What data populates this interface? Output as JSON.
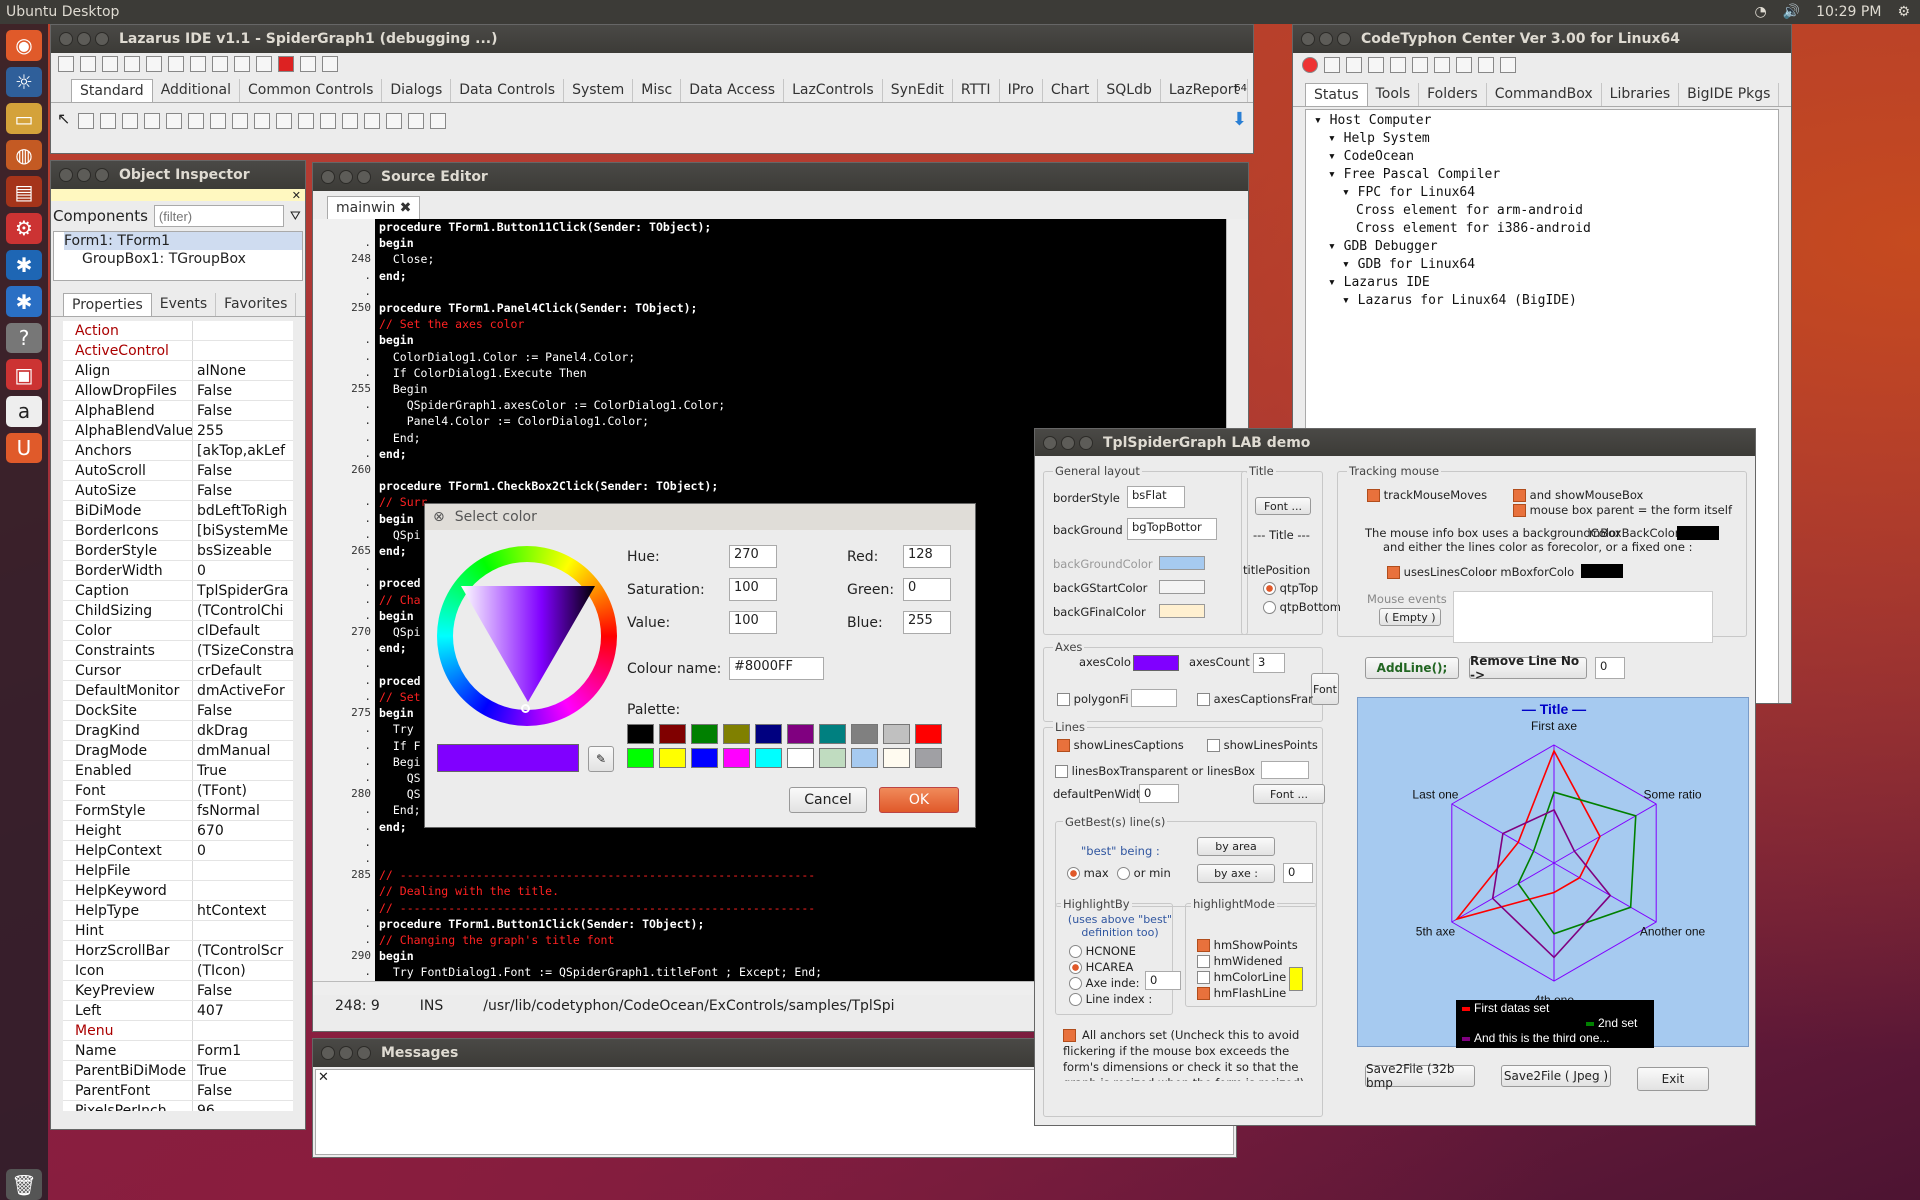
{
  "desktop": {
    "title": "Ubuntu Desktop",
    "time": "10:29 PM"
  },
  "lazarus": {
    "title": "Lazarus IDE v1.1 - SpiderGraph1 (debugging ...)",
    "tabs": [
      "Standard",
      "Additional",
      "Common Controls",
      "Dialogs",
      "Data Controls",
      "System",
      "Misc",
      "Data Access",
      "LazControls",
      "SynEdit",
      "RTTI",
      "IPro",
      "Chart",
      "SQLdb",
      "LazReport"
    ],
    "bits": "64"
  },
  "oi": {
    "title": "Object Inspector",
    "components_label": "Components",
    "filter_placeholder": "(filter)",
    "tree": [
      "Form1: TForm1",
      "GroupBox1: TGroupBox"
    ],
    "tabs": [
      "Properties",
      "Events",
      "Favorites"
    ],
    "props": [
      [
        "Action",
        ""
      ],
      [
        "ActiveControl",
        ""
      ],
      [
        "Align",
        "alNone"
      ],
      [
        "AllowDropFiles",
        "False"
      ],
      [
        "AlphaBlend",
        "False"
      ],
      [
        "AlphaBlendValue",
        "255"
      ],
      [
        "Anchors",
        "[akTop,akLef"
      ],
      [
        "AutoScroll",
        "False"
      ],
      [
        "AutoSize",
        "False"
      ],
      [
        "BiDiMode",
        "bdLeftToRigh"
      ],
      [
        "BorderIcons",
        "[biSystemMe"
      ],
      [
        "BorderStyle",
        "bsSizeable"
      ],
      [
        "BorderWidth",
        "0"
      ],
      [
        "Caption",
        "TplSpiderGra"
      ],
      [
        "ChildSizing",
        "(TControlChi"
      ],
      [
        "Color",
        "clDefault"
      ],
      [
        "Constraints",
        "(TSizeConstra"
      ],
      [
        "Cursor",
        "crDefault"
      ],
      [
        "DefaultMonitor",
        "dmActiveFor"
      ],
      [
        "DockSite",
        "False"
      ],
      [
        "DragKind",
        "dkDrag"
      ],
      [
        "DragMode",
        "dmManual"
      ],
      [
        "Enabled",
        "True"
      ],
      [
        "Font",
        "(TFont)"
      ],
      [
        "FormStyle",
        "fsNormal"
      ],
      [
        "Height",
        "670"
      ],
      [
        "HelpContext",
        "0"
      ],
      [
        "HelpFile",
        ""
      ],
      [
        "HelpKeyword",
        ""
      ],
      [
        "HelpType",
        "htContext"
      ],
      [
        "Hint",
        ""
      ],
      [
        "HorzScrollBar",
        "(TControlScr"
      ],
      [
        "Icon",
        "(TIcon)"
      ],
      [
        "KeyPreview",
        "False"
      ],
      [
        "Left",
        "407"
      ],
      [
        "Menu",
        ""
      ],
      [
        "Name",
        "Form1"
      ],
      [
        "ParentBiDiMode",
        "True"
      ],
      [
        "ParentFont",
        "False"
      ],
      [
        "PixelsPerInch",
        "96"
      ]
    ]
  },
  "editor": {
    "title": "Source Editor",
    "tab": "mainwin",
    "status_pos": "248:  9",
    "status_mode": "INS",
    "status_path": "/usr/lib/codetyphon/CodeOcean/ExControls/samples/TplSpi",
    "gutter": [
      "",
      ".",
      "248",
      ".",
      ".",
      "250",
      "",
      ".",
      ".",
      ".",
      "255",
      ".",
      ".",
      ".",
      ".",
      "260",
      "",
      ".",
      ".",
      ".",
      "265",
      ".",
      ".",
      ".",
      ".",
      "270",
      ".",
      ".",
      ".",
      ".",
      "275",
      ".",
      ".",
      ".",
      ".",
      "280",
      ".",
      ".",
      ".",
      ".",
      "285",
      "",
      ".",
      ".",
      ".",
      "290",
      ".",
      ".",
      "."
    ],
    "lines": [
      [
        "kw",
        "procedure TForm1.Button11Click(Sender: TObject);"
      ],
      [
        "kw",
        "begin"
      ],
      [
        "",
        "  Close;"
      ],
      [
        "kw",
        "end;"
      ],
      [
        "",
        ""
      ],
      [
        "kw",
        "procedure TForm1.Panel4Click(Sender: TObject);"
      ],
      [
        "cm",
        "// Set the axes color"
      ],
      [
        "kw",
        "begin"
      ],
      [
        "",
        "  ColorDialog1.Color := Panel4.Color;"
      ],
      [
        "",
        "  If ColorDialog1.Execute Then"
      ],
      [
        "",
        "  Begin"
      ],
      [
        "",
        "    QSpiderGraph1.axesColor := ColorDialog1.Color;"
      ],
      [
        "",
        "    Panel4.Color := ColorDialog1.Color;"
      ],
      [
        "",
        "  End;"
      ],
      [
        "kw",
        "end;"
      ],
      [
        "",
        ""
      ],
      [
        "kw",
        "procedure TForm1.CheckBox2Click(Sender: TObject);"
      ],
      [
        "cm",
        "// Surr"
      ],
      [
        "kw",
        "begin"
      ],
      [
        "",
        "  QSpi"
      ],
      [
        "kw",
        "end;"
      ],
      [
        "",
        ""
      ],
      [
        "kw",
        "proced"
      ],
      [
        "cm",
        "// Cha"
      ],
      [
        "kw",
        "begin"
      ],
      [
        "",
        "  QSpi"
      ],
      [
        "kw",
        "end;"
      ],
      [
        "",
        ""
      ],
      [
        "kw",
        "proced"
      ],
      [
        "cm",
        "// Set"
      ],
      [
        "kw",
        "begin"
      ],
      [
        "",
        "  Try"
      ],
      [
        "",
        "  If F"
      ],
      [
        "",
        "  Begi"
      ],
      [
        "",
        "    QS"
      ],
      [
        "",
        "    QS"
      ],
      [
        "",
        "  End;"
      ],
      [
        "kw",
        "end;"
      ],
      [
        "",
        ""
      ],
      [
        "",
        ""
      ],
      [
        "cm",
        "// ------------------------------------------------------------"
      ],
      [
        "cm",
        "// Dealing with the title."
      ],
      [
        "cm",
        "// ------------------------------------------------------------"
      ],
      [
        "kw",
        "procedure TForm1.Button1Click(Sender: TObject);"
      ],
      [
        "cm",
        "// Changing the graph's title font"
      ],
      [
        "kw",
        "begin"
      ],
      [
        "",
        "  Try FontDialog1.Font := QSpiderGraph1.titleFont ; Except; End;"
      ]
    ]
  },
  "messages": {
    "title": "Messages"
  },
  "colordlg": {
    "title": "Select color",
    "hue_label": "Hue:",
    "hue": "270",
    "sat_label": "Saturation:",
    "sat": "100",
    "val_label": "Value:",
    "val": "100",
    "red_label": "Red:",
    "red": "128",
    "green_label": "Green:",
    "green": "0",
    "blue_label": "Blue:",
    "blue": "255",
    "name_label": "Colour name:",
    "name": "#8000FF",
    "palette_label": "Palette:",
    "cancel": "Cancel",
    "ok": "OK",
    "selected": "#8000ff",
    "palette": [
      "#000000",
      "#800000",
      "#008000",
      "#808000",
      "#000080",
      "#800080",
      "#008080",
      "#808080",
      "#c0c0c0",
      "#ff0000",
      "#00ff00",
      "#ffff00",
      "#0000ff",
      "#ff00ff",
      "#00ffff",
      "#ffffff",
      "#c0dcc0",
      "#a6caf0",
      "#fffbf0",
      "#a0a0a4"
    ]
  },
  "ctc": {
    "title": "CodeTyphon Center Ver 3.00 for Linux64",
    "tabs": [
      "Status",
      "Tools",
      "Folders",
      "CommandBox",
      "Libraries",
      "BigIDE Pkgs"
    ],
    "tree": [
      [
        0,
        "Host Computer"
      ],
      [
        1,
        "Help System"
      ],
      [
        1,
        "CodeOcean"
      ],
      [
        1,
        "Free Pascal Compiler"
      ],
      [
        2,
        "FPC for Linux64"
      ],
      [
        3,
        "Cross element for arm-android"
      ],
      [
        3,
        "Cross element for i386-android"
      ],
      [
        1,
        "GDB Debugger"
      ],
      [
        2,
        "GDB for Linux64"
      ],
      [
        1,
        "Lazarus IDE"
      ],
      [
        2,
        "Lazarus for Linux64 (BigIDE)"
      ]
    ]
  },
  "spider": {
    "title": "TplSpiderGraph LAB demo",
    "general_layout": "General layout",
    "border_style_label": "borderStyle",
    "border_style": "bsFlat",
    "background_label": "backGround",
    "background": "bgTopBottor",
    "bgcolor_label": "backGroundColor",
    "bgstart_label": "backGStartColor",
    "bgfinal_label": "backGFinalColor",
    "title_group": "Title",
    "font_btn": "Font ...",
    "title_field": "--- Title ---",
    "title_position": "titlePosition",
    "qtp_top": "qtpTop",
    "qtp_bottom": "qtpBottom",
    "tracking_group": "Tracking mouse",
    "track_moves": "trackMouseMoves",
    "show_mousebox": "and showMouseBox",
    "mousebox_parent": "mouse box parent = the form itself",
    "info_text1": "The mouse info box uses  a backgroundColor",
    "info_text2": "and either the lines color as forecolor, or a fixed one :",
    "mousebox_backcolor": "mBoxBackColor",
    "uses_lines_color": "usesLinesColor",
    "or_mbox_for": "or mBoxforColo",
    "mouse_events": "Mouse events",
    "empty_btn": "( Empty )",
    "axes_group": "Axes",
    "axes_color_label": "axesColo",
    "axes_count_label": "axesCount",
    "axes_count": "3",
    "font_short": "Font",
    "polygon_fill": "polygonFi",
    "axes_captions_frame": "axesCaptionsFrar",
    "lines_group": "Lines",
    "show_lines_captions": "showLinesCaptions",
    "show_lines_points": "showLinesPoints",
    "lines_box_transparent": "linesBoxTransparent or linesBox",
    "default_pen_width_label": "defaultPenWidt",
    "default_pen_width": "0",
    "getbest_group": "GetBest(s) line(s)",
    "best_being": "\"best\" being :",
    "by_area": "by area",
    "by_axe": "by axe :",
    "max_label": "max",
    "or_min": "or min",
    "by_axe_value": "0",
    "highlight_by_group": "HighlightBy",
    "highlight_by_note": "(uses above \"best\" definition too)",
    "hcnone": "HCNONE",
    "hcarea": "HCAREA",
    "axe_index": "Axe inde:",
    "axe_index_value": "0",
    "line_index": "Line index :",
    "highlight_mode_group": "highlightMode",
    "hm_show_points": "hmShowPoints",
    "hm_widened": "hmWidened",
    "hm_color_line": "hmColorLine",
    "hm_flash_line": "hmFlashLine",
    "add_line": "AddLine();",
    "remove_line": "Remove Line No ->",
    "remove_line_value": "0",
    "anchors_note": "All anchors set (Uncheck this to avoid flickering if the mouse box exceeds the form's  dimensions or check it so that the graph is resized when the form is resized)",
    "save_bmp": "Save2File (32b bmp",
    "save_jpeg": "Save2File ( Jpeg )",
    "exit": "Exit"
  },
  "chart_data": {
    "type": "radar",
    "title": "— Title —",
    "axes": [
      "First axe",
      "Some ratio",
      "Another one",
      "4th one",
      "5th axe",
      "Last one"
    ],
    "range": [
      0,
      1
    ],
    "axes_color": "#8000ff",
    "series": [
      {
        "name": "First datas set",
        "color": "#ff0000",
        "values": [
          0.95,
          0.45,
          0.25,
          0.25,
          0.95,
          0.35
        ]
      },
      {
        "name": "2nd set",
        "color": "#008000",
        "values": [
          0.6,
          0.8,
          0.75,
          0.6,
          0.35,
          0.2
        ]
      },
      {
        "name": "And this is the third one...",
        "color": "#800080",
        "values": [
          0.45,
          0.2,
          0.55,
          0.8,
          0.6,
          0.5
        ]
      }
    ]
  }
}
